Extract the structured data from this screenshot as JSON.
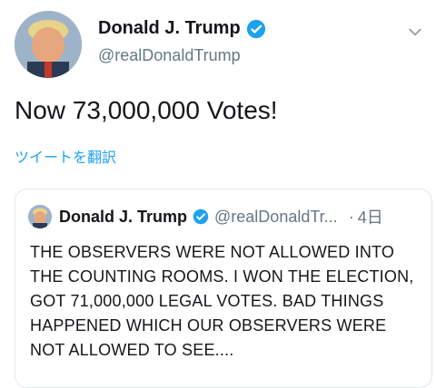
{
  "tweet": {
    "author_name": "Donald J. Trump",
    "author_handle": "@realDonaldTrump",
    "text": "Now 73,000,000 Votes!",
    "translate_label": "ツイートを翻訳",
    "verified_icon": "verified-badge-icon",
    "menu_icon": "chevron-down-icon"
  },
  "quoted_tweet": {
    "author_name": "Donald J. Trump",
    "author_handle": "@realDonaldTr...",
    "separator": "·",
    "time": "4日",
    "text": "THE OBSERVERS WERE NOT ALLOWED INTO THE COUNTING ROOMS. I WON THE ELECTION, GOT 71,000,000 LEGAL VOTES. BAD THINGS HAPPENED WHICH OUR OBSERVERS WERE NOT ALLOWED TO SEE...."
  },
  "colors": {
    "accent": "#1da1f2",
    "text_primary": "#14171a",
    "text_secondary": "#657786",
    "border": "#e1e8ed"
  }
}
